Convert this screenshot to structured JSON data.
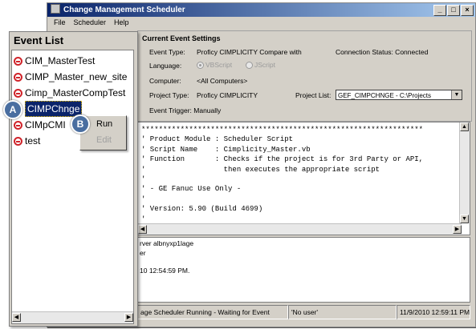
{
  "window": {
    "title": "Change Management Scheduler"
  },
  "menu": [
    "File",
    "Scheduler",
    "Help"
  ],
  "settings": {
    "header": "Current Event Settings",
    "event_type_label": "Event Type:",
    "event_type_value": "Proficy CIMPLICITY Compare with",
    "connection_status": "Connection Status:  Connected",
    "language_label": "Language:",
    "language_options": [
      "VBScript",
      "JScript"
    ],
    "language_selected": "VBScript",
    "computer_label": "Computer:",
    "computer_value": "<All Computers>",
    "project_type_label": "Project Type:",
    "project_type_value": "Proficy CIMPLICITY",
    "project_list_label": "Project List:",
    "project_list_value": "GEF_CIMPCHNGE - C:\\Projects",
    "event_trigger": "Event Trigger:  Manually"
  },
  "script_text": "*****************************************************************\n' Product Module : Scheduler Script\n' Script Name    : Cimplicity_Master.vb\n' Function       : Checks if the project is for 3rd Party or API,\n'                  then executes the appropriate script\n'\n' - GE Fanuc Use Only -\n'\n' Version: 5.90 (Build 4699)\n'",
  "log": [
    "rver albnyxp1lage",
    "er",
    "10 12:54:59 PM."
  ],
  "status": {
    "message": "age Scheduler Running - Waiting for Event",
    "user": "'No user'",
    "datetime": "11/9/2010 12:59:11 PM"
  },
  "event_list": {
    "title": "Event List",
    "items": [
      "CIM_MasterTest",
      "CIMP_Master_new_site",
      "Cimp_MasterCompTest",
      "CIMPChnge",
      "CIMpCMI",
      "test"
    ],
    "selected": "CIMPChnge"
  },
  "context_menu": {
    "run": "Run",
    "edit": "Edit"
  },
  "badges": {
    "a": "A",
    "b": "B"
  },
  "colors": {
    "selection": "#0a246a",
    "event_icon": "#d0242a",
    "badge": "#4a6ea0"
  }
}
